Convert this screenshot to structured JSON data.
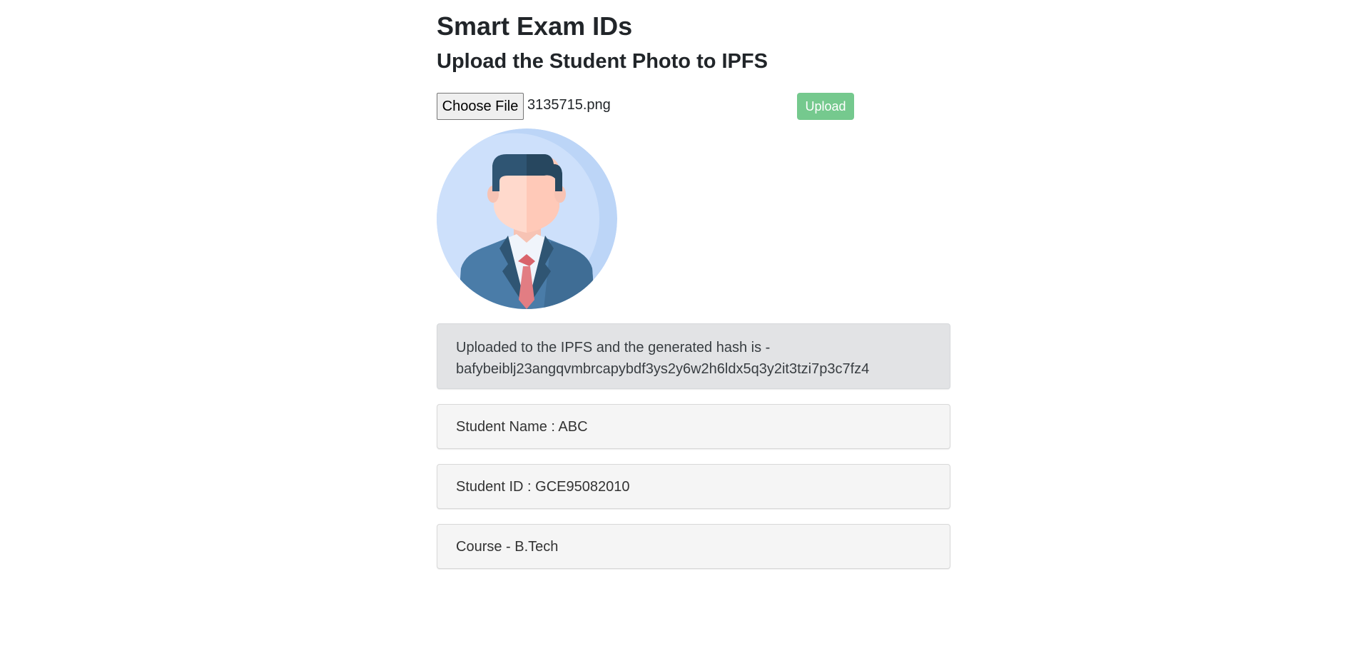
{
  "page": {
    "title": "Smart Exam IDs",
    "subtitle": "Upload the Student Photo to IPFS"
  },
  "upload": {
    "choose_label": "Choose File",
    "file_name": "3135715.png",
    "upload_label": "Upload"
  },
  "avatar": {
    "icon": "student-avatar-icon",
    "colors": {
      "circle": "#cde0fb",
      "hair": "#2f5573",
      "skin": "#ffd9cc",
      "suit": "#4a7ca8",
      "tie": "#e27d83"
    }
  },
  "result": {
    "line1": "Uploaded to the IPFS and the generated hash is -",
    "hash": "bafybeiblj23angqvmbrcapybdf3ys2y6w2h6ldx5q3y2it3tzi7p3c7fz4"
  },
  "student": {
    "name": "Student Name : ABC",
    "id": "Student ID : GCE95082010",
    "course": "Course - B.Tech"
  },
  "colors": {
    "upload_button": "#75c98e",
    "hash_panel": "#e2e3e5",
    "info_panel": "#f5f5f5"
  }
}
